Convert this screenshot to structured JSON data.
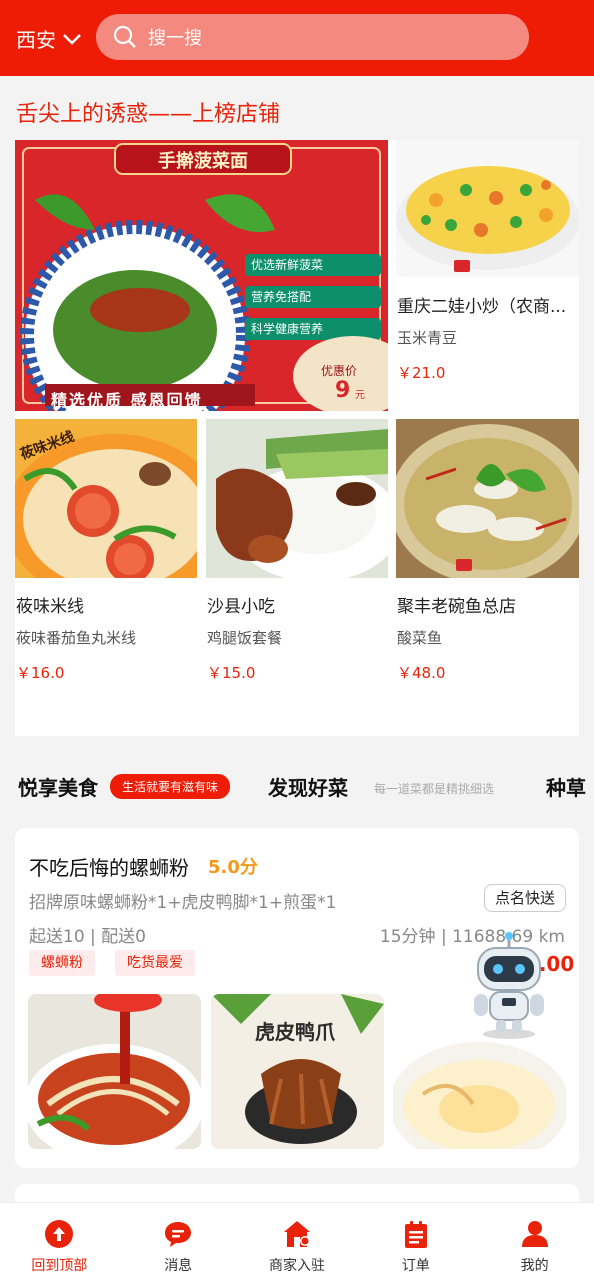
{
  "header": {
    "city": "西安",
    "search_placeholder": "搜一搜"
  },
  "section_title": "舌尖上的诱惑——上榜店铺",
  "featured_banner": {
    "title": "手擀菠菜面",
    "features": [
      "优选新鲜菠菜",
      "营养免搭配",
      "科学健康营养"
    ],
    "price_label": "优惠价",
    "price": "9",
    "price_unit": "元",
    "slogan": "精选优质 感恩回馈"
  },
  "featured_shops": [
    {
      "shop": "重庆二娃小炒（农商...",
      "dish": "玉米青豆",
      "price": "￥21.0"
    },
    {
      "shop": "莜味米线",
      "dish": "莜味番茄鱼丸米线",
      "price": "￥16.0",
      "img_text": "莜味米线"
    },
    {
      "shop": "沙县小吃",
      "dish": "鸡腿饭套餐",
      "price": "￥15.0"
    },
    {
      "shop": "聚丰老碗鱼总店",
      "dish": "酸菜鱼",
      "price": "￥48.0"
    }
  ],
  "tabs": {
    "tab1": "悦享美食",
    "tab1_pill": "生活就要有滋有味",
    "tab2": "发现好菜",
    "tab2_sub": "每一道菜都是精挑细选",
    "tab3": "种草"
  },
  "shop_card": {
    "name": "不吃后悔的螺蛳粉",
    "rating": "5.0分",
    "combo": "招牌原味螺蛳粉*1+虎皮鸭脚*1+煎蛋*1",
    "quick_button": "点名快送",
    "delivery": "起送10 | 配送0",
    "distance": "15分钟 | 11688.69 km",
    "tags": [
      "螺蛳粉",
      "吃货最爱"
    ],
    "price": "￥16.00",
    "thumb2_text": "虎皮鸭爪"
  },
  "bottom_nav": [
    {
      "label": "回到顶部",
      "icon": "arrow-up-circle-icon"
    },
    {
      "label": "消息",
      "icon": "message-icon"
    },
    {
      "label": "商家入驻",
      "icon": "store-icon"
    },
    {
      "label": "订单",
      "icon": "order-icon"
    },
    {
      "label": "我的",
      "icon": "user-icon"
    }
  ],
  "colors": {
    "brand": "#ee1c05",
    "price": "#e8230a",
    "rating": "#f19a1c"
  }
}
